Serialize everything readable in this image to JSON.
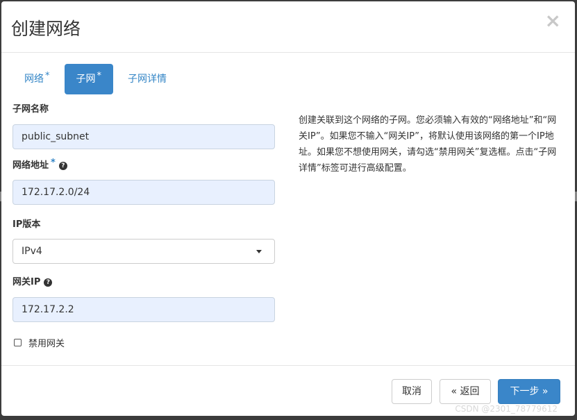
{
  "modal": {
    "title": "创建网络",
    "close_symbol": "×"
  },
  "tabs": [
    {
      "label": "网络",
      "required": "*",
      "active": false
    },
    {
      "label": "子网",
      "required": "*",
      "active": true
    },
    {
      "label": "子网详情",
      "required": "",
      "active": false
    }
  ],
  "form": {
    "subnet_name": {
      "label": "子网名称",
      "value": "public_subnet"
    },
    "network_address": {
      "label": "网络地址",
      "required": "*",
      "help_icon": "?",
      "value": "172.17.2.0/24"
    },
    "ip_version": {
      "label": "IP版本",
      "selected": "IPv4"
    },
    "gateway_ip": {
      "label": "网关IP",
      "help_icon": "?",
      "value": "172.17.2.2"
    },
    "disable_gateway": {
      "label": "禁用网关",
      "checked": false
    }
  },
  "description": "创建关联到这个网络的子网。您必须输入有效的“网络地址”和“网关IP”。如果您不输入“网关IP”，将默认使用该网络的第一个IP地址。如果您不想使用网关，请勾选“禁用网关”复选框。点击“子网详情”标签可进行高级配置。",
  "footer": {
    "cancel_label": "取消",
    "back_label": "« 返回",
    "next_label": "下一步 »"
  },
  "watermark": "CSDN @2301_78779612",
  "colors": {
    "accent": "#3a86c9",
    "input_bg": "#e8f0fe",
    "link": "#3385c6"
  }
}
